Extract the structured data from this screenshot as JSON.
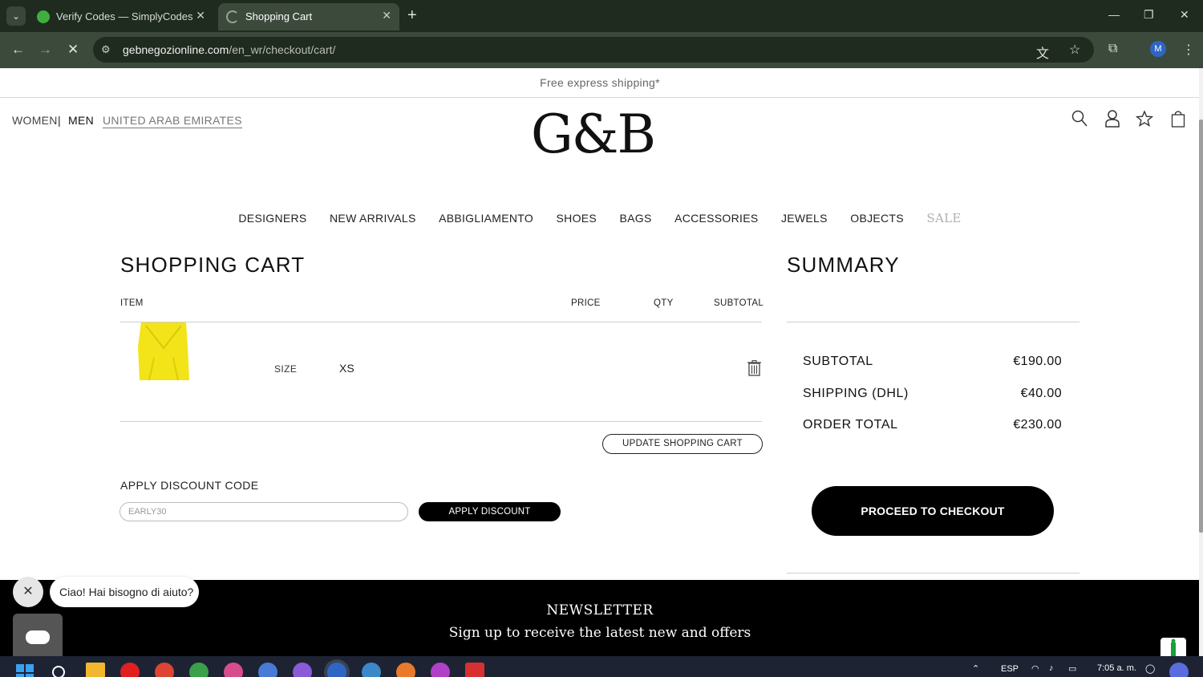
{
  "browser": {
    "tabs": [
      {
        "title": "Verify Codes — SimplyCodes",
        "active": false,
        "favicon": "simplycodes-icon",
        "favicon_color": "#3fae3f"
      },
      {
        "title": "Shopping Cart",
        "active": true,
        "favicon": "loading-spinner-icon"
      }
    ],
    "url_host": "gebnegozionline.com",
    "url_path": "/en_wr/checkout/cart/",
    "profile_initial": "M"
  },
  "site": {
    "shipping_banner": "Free express shipping*",
    "header": {
      "gender_women": "WOMEN",
      "gender_men": "MEN",
      "country": "UNITED ARAB EMIRATES",
      "logo": "G&B"
    },
    "nav": [
      "DESIGNERS",
      "NEW ARRIVALS",
      "ABBIGLIAMENTO",
      "SHOES",
      "BAGS",
      "ACCESSORIES",
      "JEWELS",
      "OBJECTS",
      "SALE"
    ],
    "cart": {
      "title": "SHOPPING CART",
      "columns": {
        "item": "ITEM",
        "price": "PRICE",
        "qty": "QTY",
        "subtotal": "SUBTOTAL"
      },
      "item": {
        "size_label": "SIZE",
        "size_value": "XS",
        "image": "yellow-top-product",
        "image_color": "#f2e418"
      },
      "update_button": "UPDATE SHOPPING CART",
      "discount": {
        "heading": "APPLY DISCOUNT CODE",
        "input_value": "EARLY30",
        "button": "APPLY DISCOUNT"
      }
    },
    "summary": {
      "title": "SUMMARY",
      "subtotal_label": "SUBTOTAL",
      "subtotal_value": "€190.00",
      "shipping_label": "SHIPPING (DHL)",
      "shipping_value": "€40.00",
      "total_label": "ORDER TOTAL",
      "total_value": "€230.00",
      "checkout_button": "PROCEED TO CHECKOUT"
    },
    "newsletter": {
      "title": "NEWSLETTER",
      "subtitle": "Sign up to receive the latest new and offers"
    },
    "chat": {
      "message": "Ciao! Hai bisogno di aiuto?"
    }
  },
  "taskbar": {
    "language": "ESP",
    "time": "7:05 a. m."
  },
  "colors": {
    "chrome_dark": "#1f2b1f",
    "chrome_toolbar": "#3c4a3c",
    "accent_black": "#000000",
    "sale_grey": "#b0b0b0"
  }
}
